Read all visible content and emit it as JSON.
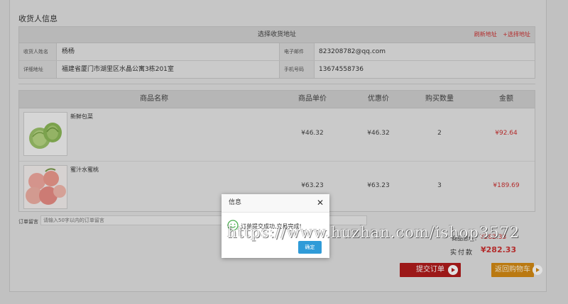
{
  "section_title": "收货人信息",
  "address": {
    "header": "选择收货地址",
    "links": [
      "刷新地址",
      "+选择地址"
    ],
    "name_label": "收货人姓名",
    "name_value": "杨杨",
    "email_label": "电子邮件",
    "email_value": "823208782@qq.com",
    "detail_label": "详细地址",
    "detail_value": "福建省厦门市湖里区水晶公寓3栋201室",
    "phone_label": "手机号码",
    "phone_value": "13674558736"
  },
  "goods": {
    "columns": [
      "商品名称",
      "商品单价",
      "优惠价",
      "购买数量",
      "金额"
    ],
    "rows": [
      {
        "name": "新鲜包菜",
        "price": "¥46.32",
        "discount": "¥46.32",
        "qty": "2",
        "amount": "¥92.64",
        "thumb": "cabbage-icon"
      },
      {
        "name": "蜜汁水蜜桃",
        "price": "¥63.23",
        "discount": "¥63.23",
        "qty": "3",
        "amount": "¥189.69",
        "thumb": "peach-icon"
      }
    ]
  },
  "memo": {
    "label": "订单留言",
    "placeholder": "请输入50字以内的订单留言"
  },
  "summary": {
    "total_label": "商品总价：",
    "total_value": "¥282.33",
    "pay_label": "实付款",
    "pay_value": "¥282.33"
  },
  "buttons": {
    "submit": "提交订单",
    "back": "返回购物车"
  },
  "dialog": {
    "title": "信息",
    "message": "订单提交成功,交易完成!",
    "ok": "确定",
    "icon": "smile-icon"
  },
  "watermark": "https://www.huzhan.com/ishop3572",
  "colors": {
    "accent_red": "#cc3333",
    "submit_bg": "#b21c1c",
    "back_bg": "#d48a14",
    "ok_bg": "#2f9bd8"
  }
}
